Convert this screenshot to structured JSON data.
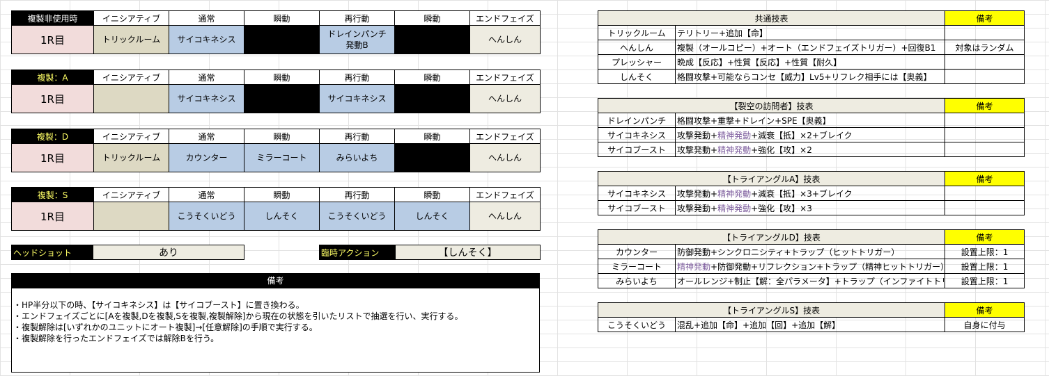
{
  "rounds": [
    {
      "title": "複製非使用時",
      "headers": [
        "イニシアティブ",
        "通常",
        "瞬動",
        "再行動",
        "瞬動",
        "エンドフェイズ"
      ],
      "row_label": "1R目",
      "cells": [
        "トリックルーム",
        "サイコキネシス",
        "",
        "ドレインパンチ\n発動B",
        "",
        "へんしん"
      ]
    },
    {
      "title": "複製：A",
      "headers": [
        "イニシアティブ",
        "通常",
        "瞬動",
        "再行動",
        "瞬動",
        "エンドフェイズ"
      ],
      "row_label": "1R目",
      "cells": [
        "",
        "サイコキネシス",
        "",
        "サイコキネシス",
        "",
        "へんしん"
      ]
    },
    {
      "title": "複製：D",
      "headers": [
        "イニシアティブ",
        "通常",
        "瞬動",
        "再行動",
        "瞬動",
        "エンドフェイズ"
      ],
      "row_label": "1R目",
      "cells": [
        "トリックルーム",
        "カウンター",
        "ミラーコート",
        "みらいよち",
        "",
        "へんしん"
      ]
    },
    {
      "title": "複製：S",
      "headers": [
        "イニシアティブ",
        "通常",
        "瞬動",
        "再行動",
        "瞬動",
        "エンドフェイズ"
      ],
      "row_label": "1R目",
      "cells": [
        "",
        "こうそくいどう",
        "しんそく",
        "こうそくいどう",
        "しんそく",
        "へんしん"
      ]
    }
  ],
  "headshot": {
    "label": "ヘッドショット",
    "value": "あり"
  },
  "temp_action": {
    "label": "臨時アクション",
    "value": "【しんそく】"
  },
  "notes": {
    "title": "備考",
    "lines": [
      "・HP半分以下の時、【サイコキネシス】は【サイコブースト】に置き換わる。",
      "・エンドフェイズごとに[Aを複製,Dを複製,Sを複製,複製解除]から現在の状態を引いたリストで抽選を行い、実行する。",
      "・複製解除は[いずれかのユニットにオート複製]→[任意解除]の手順で実行する。",
      "・複製解除を行ったエンドフェイズでは解除Bを行う。"
    ]
  },
  "skill_tables": [
    {
      "title": "共通技表",
      "note_header": "備考",
      "rows": [
        {
          "name": "トリックルーム",
          "desc": [
            {
              "t": "テリトリー+追加【命】"
            }
          ],
          "note": ""
        },
        {
          "name": "へんしん",
          "desc": [
            {
              "t": "複製（オールコピー）+オート（エンドフェイズトリガー）+回復B1"
            }
          ],
          "note": "対象はランダム"
        },
        {
          "name": "プレッシャー",
          "desc": [
            {
              "t": "晩成【反応】+性質【反応】+性質【耐久】"
            }
          ],
          "note": ""
        },
        {
          "name": "しんそく",
          "desc": [
            {
              "t": "格闘攻撃+可能ならコンセ【威力】Lv5+リフレク相手には【奥義】"
            }
          ],
          "note": ""
        }
      ]
    },
    {
      "title": "【裂空の訪問者】技表",
      "note_header": "備考",
      "rows": [
        {
          "name": "ドレインパンチ",
          "desc": [
            {
              "t": "格闘攻撃+重撃+ドレイン+SPE【奥義】"
            }
          ],
          "note": ""
        },
        {
          "name": "サイコキネシス",
          "desc": [
            {
              "t": "攻撃発動+"
            },
            {
              "t": "精神発動",
              "p": true
            },
            {
              "t": "+減衰【抵】×2+ブレイク"
            }
          ],
          "note": ""
        },
        {
          "name": "サイコブースト",
          "desc": [
            {
              "t": "攻撃発動+"
            },
            {
              "t": "精神発動",
              "p": true
            },
            {
              "t": "+強化【攻】×2"
            }
          ],
          "note": ""
        }
      ]
    },
    {
      "title": "【トライアングルA】技表",
      "note_header": "備考",
      "rows": [
        {
          "name": "サイコキネシス",
          "desc": [
            {
              "t": "攻撃発動+"
            },
            {
              "t": "精神発動",
              "p": true
            },
            {
              "t": "+減衰【抵】×3+ブレイク"
            }
          ],
          "note": ""
        },
        {
          "name": "サイコブースト",
          "desc": [
            {
              "t": "攻撃発動+"
            },
            {
              "t": "精神発動",
              "p": true
            },
            {
              "t": "+強化【攻】×3"
            }
          ],
          "note": ""
        }
      ]
    },
    {
      "title": "【トライアングルD】技表",
      "note_header": "備考",
      "rows": [
        {
          "name": "カウンター",
          "desc": [
            {
              "t": "防御発動+シンクロニシティ+トラップ（ヒットトリガー）"
            }
          ],
          "note": "設置上限：1"
        },
        {
          "name": "ミラーコート",
          "desc": [
            {
              "t": "精神発動",
              "p": true
            },
            {
              "t": "+防御発動+リフレクション+トラップ（精神ヒットトリガー）"
            }
          ],
          "note": "設置上限：1"
        },
        {
          "name": "みらいよち",
          "desc": [
            {
              "t": "オールレンジ+制止【解：全パラメータ】+トラップ（インファイトトリガー）"
            }
          ],
          "note": "設置上限：1"
        }
      ]
    },
    {
      "title": "【トライアングルS】技表",
      "note_header": "備考",
      "rows": [
        {
          "name": "こうそくいどう",
          "desc": [
            {
              "t": "混乱+追加【命】+追加【回】+追加【解】"
            }
          ],
          "note": "自身に付与"
        }
      ]
    }
  ]
}
